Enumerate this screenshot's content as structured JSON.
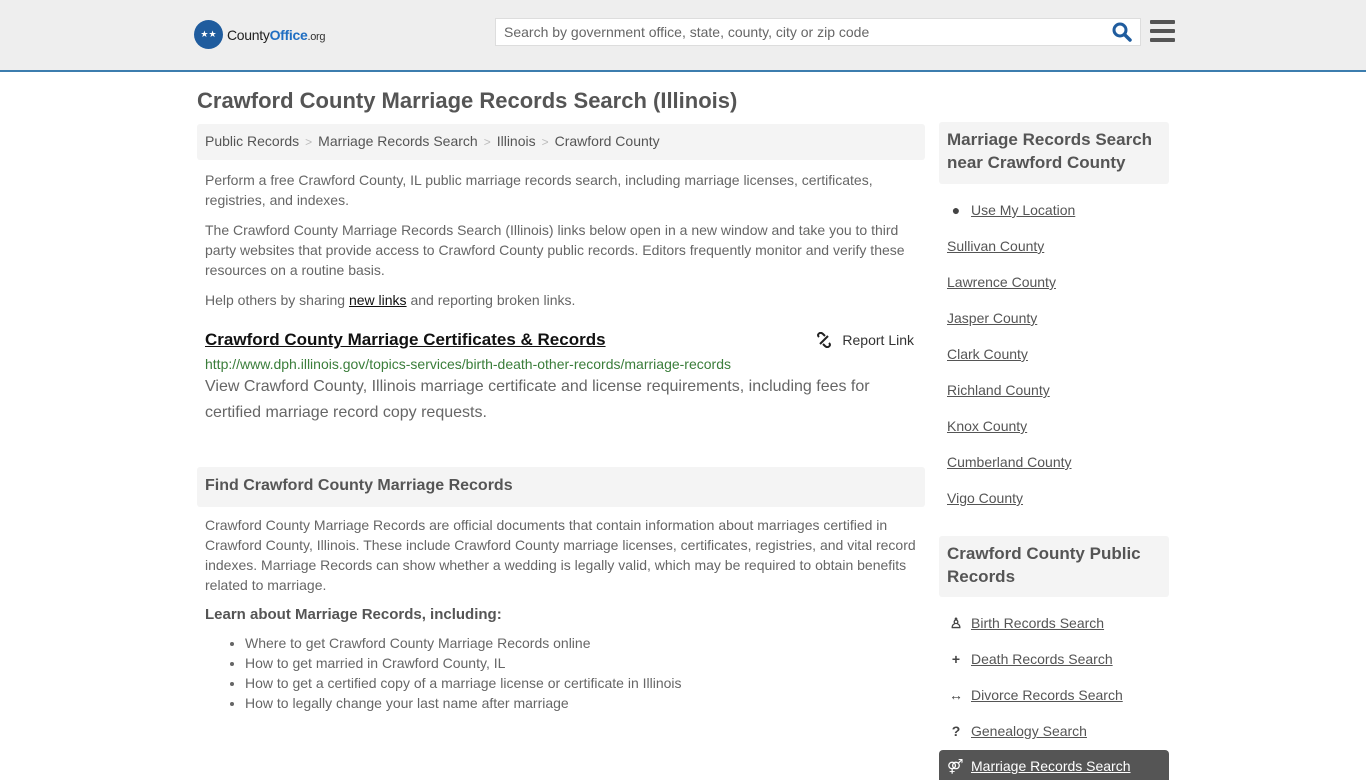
{
  "header": {
    "logo": {
      "brand_prefix": "County",
      "brand_accent": "Office",
      "brand_suffix": ".org"
    },
    "search_placeholder": "Search by government office, state, county, city or zip code",
    "accent_color": "#3c7dae"
  },
  "page_title": "Crawford County Marriage Records Search (Illinois)",
  "breadcrumb": [
    "Public Records",
    "Marriage Records Search",
    "Illinois",
    "Crawford County"
  ],
  "intro": {
    "p1": "Perform a free Crawford County, IL public marriage records search, including marriage licenses, certificates, registries, and indexes.",
    "p2": "The Crawford County Marriage Records Search (Illinois) links below open in a new window and take you to third party websites that provide access to Crawford County public records. Editors frequently monitor and verify these resources on a routine basis.",
    "p3_before": "Help others by sharing ",
    "p3_link": "new links",
    "p3_after": " and reporting broken links."
  },
  "result": {
    "title": "Crawford County Marriage Certificates & Records",
    "report_label": "Report Link",
    "url": "http://www.dph.illinois.gov/topics-services/birth-death-other-records/marriage-records",
    "description": "View Crawford County, Illinois marriage certificate and license requirements, including fees for certified marriage record copy requests."
  },
  "find_section": {
    "heading": "Find Crawford County Marriage Records",
    "body": "Crawford County Marriage Records are official documents that contain information about marriages certified in Crawford County, Illinois. These include Crawford County marriage licenses, certificates, registries, and vital record indexes. Marriage Records can show whether a wedding is legally valid, which may be required to obtain benefits related to marriage.",
    "learn_heading": "Learn about Marriage Records, including:",
    "learn_items": [
      "Where to get Crawford County Marriage Records online",
      "How to get married in Crawford County, IL",
      "How to get a certified copy of a marriage license or certificate in Illinois",
      "How to legally change your last name after marriage"
    ]
  },
  "sidebar": {
    "nearby_heading": "Marriage Records Search near Crawford County",
    "use_location": "Use My Location",
    "nearby": [
      "Sullivan County",
      "Lawrence County",
      "Jasper County",
      "Clark County",
      "Richland County",
      "Knox County",
      "Cumberland County",
      "Vigo County"
    ],
    "public_heading": "Crawford County Public Records",
    "public_links": [
      {
        "label": "Birth Records Search",
        "icon": "child-icon"
      },
      {
        "label": "Death Records Search",
        "icon": "plus-icon"
      },
      {
        "label": "Divorce Records Search",
        "icon": "arrows-h-icon"
      },
      {
        "label": "Genealogy Search",
        "icon": "question-icon"
      }
    ],
    "active_link": {
      "label": "Marriage Records Search",
      "icon": "intersex-icon"
    }
  }
}
